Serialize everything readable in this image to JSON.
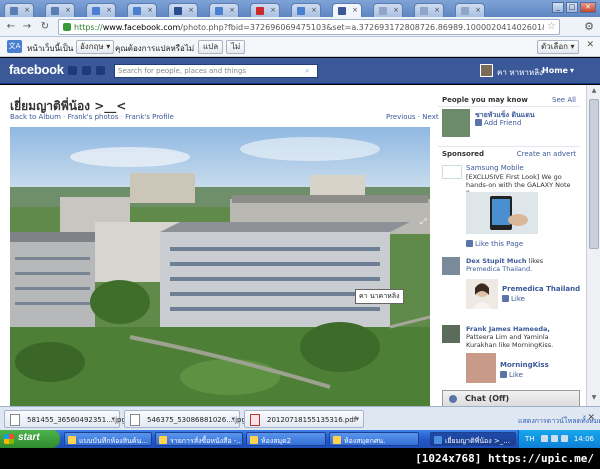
{
  "browser": {
    "url_scheme": "https://",
    "url_host": "www.facebook.com",
    "url_path": "/photo.php?fbid=372696069475103&set=a.372693172808726.86989.100002041402601&type=1&co",
    "tab_colors": [
      "#5a7db3",
      "#5a7db3",
      "#4a7fd0",
      "#4a7fd0",
      "#2a4e8f",
      "#4a7fd0",
      "#cc2b2b",
      "#4a7fd0",
      "#3b5998",
      "#8fa6c9",
      "#8fa6c9",
      "#8fa6c9"
    ]
  },
  "translate": {
    "icon_label": "文A",
    "prompt": "หน้าเว็บนี้เป็น",
    "language": "อังกฤษ",
    "question": "คุณต้องการแปลหรือไม่",
    "translate_button": "แปล",
    "no_button": "ไม่",
    "options_button": "ตัวเลือก"
  },
  "fb": {
    "logo": "facebook",
    "search_placeholder": "Search for people, places and things",
    "user_name": "คา หาหาหลิง",
    "nav_home": "Home"
  },
  "photo": {
    "title": "เยี่ยมญาติพี่น้อง >__<",
    "back_link": "Back to Album",
    "sep": "·",
    "owner_photos": "Frank's photos",
    "owner_profile": "Frank's Profile",
    "previous": "Previous",
    "next": "Next",
    "tag_label": "คา นาคาหลิง"
  },
  "sidebar": {
    "pymk_header": "People you may know",
    "see_all": "See All",
    "pymk_name": "ชายหัวแข็ง ดินแดน",
    "add_friend": "Add Friend",
    "sponsored": "Sponsored",
    "create_ad": "Create an advert",
    "ad1_title": "Samsung Mobile",
    "ad1_body": "[EXCLUSIVE First Look] We go hands-on with the GALAXY Note II.",
    "ad1_like": "Like this Page",
    "ad2_name": "Dex Stupit Much",
    "ad2_likes": "likes",
    "ad2_page": "Premedica Thailand.",
    "ad2_page_title": "Premedica Thailand",
    "ad2_like": "Like",
    "ad3_names": "Frank James Hameeda,",
    "ad3_names_rest": "Patteera Lim and Yaminla Kurakhan like MorningKiss.",
    "ad3_title": "MorningKiss",
    "ad3_like": "Like",
    "chat": "Chat (Off)"
  },
  "downloads": {
    "items": [
      "581455_36560492351....jpg",
      "546375_53086881026....jpg",
      "20120718155135316.pdf"
    ],
    "show_all": "แสดงการดาวน์โหลดทั้งหมด..."
  },
  "taskbar": {
    "start": "start",
    "tasks": [
      "แบบบันทึกห้องสินค้น...",
      "รายการสั่งซื้อหนังสือ -...",
      "ห้องสมุด2",
      "ห้องสมุดกศน.",
      "เยี่ยมญาติพี่น้อง >_..."
    ],
    "lang": "TH",
    "clock": "14:06"
  },
  "footer": {
    "watermark": "[1024x768] https://upic.me/"
  }
}
